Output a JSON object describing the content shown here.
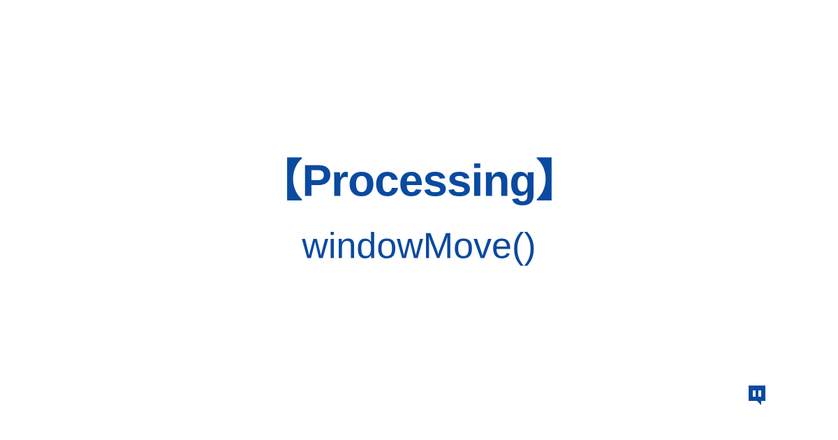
{
  "main": {
    "title": "【Processing】",
    "subtitle": "windowMove()"
  },
  "colors": {
    "primary": "#0a4aa0",
    "background": "#ffffff"
  }
}
